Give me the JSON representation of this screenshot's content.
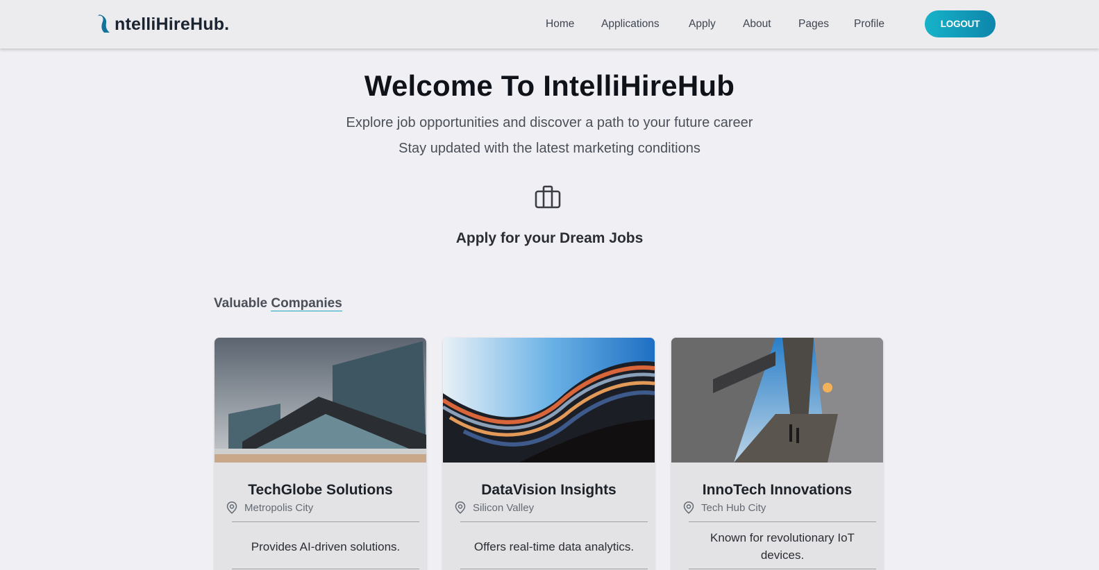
{
  "brand": {
    "name": "ntelliHireHub."
  },
  "nav": {
    "links": [
      "Home",
      "Applications",
      "Apply",
      "About",
      "Pages",
      "Profile"
    ],
    "logout_label": "LOGOUT"
  },
  "hero": {
    "title": "Welcome To IntelliHireHub",
    "subtitle_1": "Explore job opportunities and discover a path to your future career",
    "subtitle_2": "Stay updated with the latest marketing conditions",
    "cta_icon": "briefcase-icon",
    "cta_text": "Apply for your Dream Jobs"
  },
  "companies_section": {
    "title_part1": "Valuable ",
    "title_part2": "Companies",
    "cards": [
      {
        "name": "TechGlobe Solutions",
        "location": "Metropolis City",
        "description": "Provides AI-driven solutions."
      },
      {
        "name": "DataVision Insights",
        "location": "Silicon Valley",
        "description": "Offers real-time data analytics."
      },
      {
        "name": "InnoTech Innovations",
        "location": "Tech Hub City",
        "description": "Known for revolutionary IoT devices."
      }
    ]
  },
  "colors": {
    "accent": "#17b3c9",
    "accent_dark": "#0d86ab",
    "background": "#f0eff4",
    "header_bg": "#ececee",
    "card_bg": "#e3e3e5"
  }
}
